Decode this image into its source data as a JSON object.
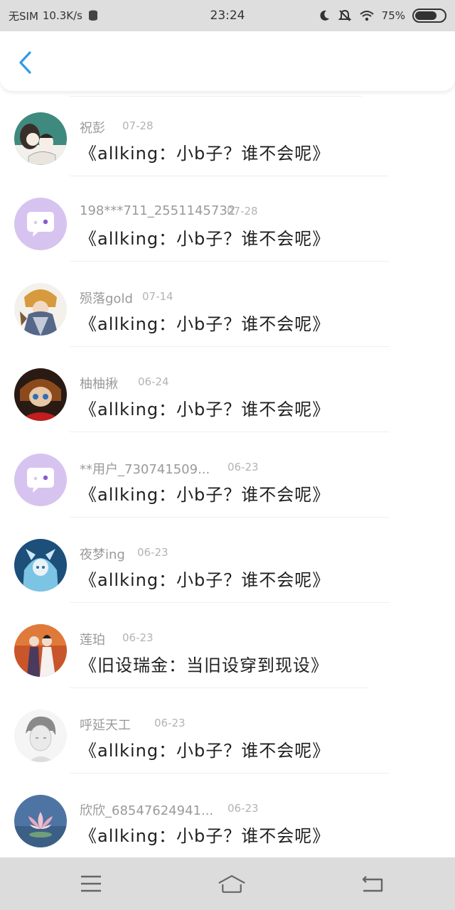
{
  "status_bar": {
    "carrier": "无SIM",
    "speed": "10.3K/s",
    "time": "23:24",
    "battery": "75%",
    "battery_level": 0.75
  },
  "header": {
    "back_icon": "chevron-left-icon",
    "accent": "#2f9be6"
  },
  "comments": [
    {
      "name": "祝彭",
      "date": "07-28",
      "message": "《allking：小b子？谁不会呢》",
      "avatar": "anime-couple-avatar"
    },
    {
      "name": "198***711_2551145732",
      "date": "07-28",
      "message": "《allking：小b子？谁不会呢》",
      "avatar": "default-chat-avatar"
    },
    {
      "name": "殒落gold",
      "date": "07-14",
      "message": "《allking：小b子？谁不会呢》",
      "avatar": "anime-character-avatar"
    },
    {
      "name": "柚柚揪",
      "date": "06-24",
      "message": "《allking：小b子？谁不会呢》",
      "avatar": "anime-red-avatar"
    },
    {
      "name": "**用户_730741509...",
      "date": "06-23",
      "message": "《allking：小b子？谁不会呢》",
      "avatar": "default-chat-avatar"
    },
    {
      "name": "夜梦ing",
      "date": "06-23",
      "message": "《allking：小b子？谁不会呢》",
      "avatar": "anime-blue-avatar"
    },
    {
      "name": "莲珀",
      "date": "06-23",
      "message": "《旧设瑞金：当旧设穿到现设》",
      "avatar": "anime-costume-avatar"
    },
    {
      "name": "呼延天工",
      "date": "06-23",
      "message": "《allking：小b子？谁不会呢》",
      "avatar": "sketch-portrait-avatar"
    },
    {
      "name": "欣欣_68547624941...",
      "date": "06-23",
      "message": "《allking：小b子？谁不会呢》",
      "avatar": "lotus-avatar"
    }
  ],
  "nav_bar": {
    "menu_icon": "menu-icon",
    "home_icon": "home-icon",
    "back_icon": "back-icon"
  }
}
